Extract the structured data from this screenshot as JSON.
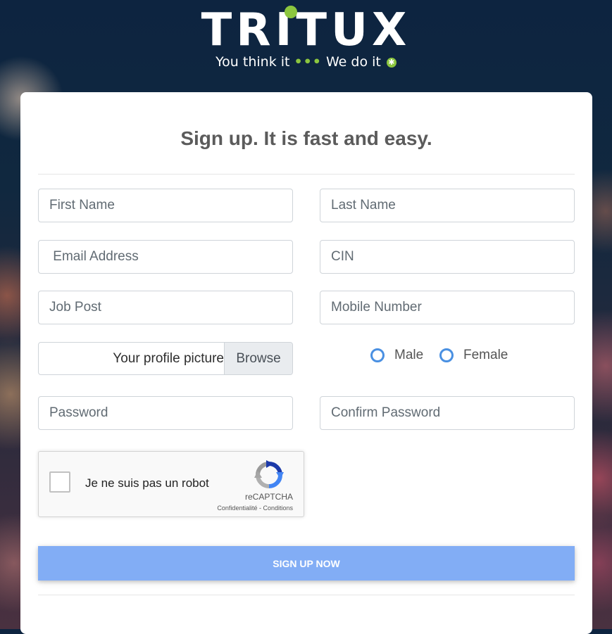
{
  "logo": {
    "name": "TRITUX",
    "tagline_part1": "You think it",
    "tagline_dots": "•••",
    "tagline_part2": "We do it",
    "tagline_symbol": "✱"
  },
  "form": {
    "title": "Sign up. It is fast and easy.",
    "fields": {
      "first_name": {
        "placeholder": "First Name",
        "value": ""
      },
      "last_name": {
        "placeholder": "Last Name",
        "value": ""
      },
      "email": {
        "placeholder": " Email Address",
        "value": ""
      },
      "cin": {
        "placeholder": "CIN",
        "value": ""
      },
      "job_post": {
        "placeholder": "Job Post",
        "value": ""
      },
      "mobile": {
        "placeholder": "Mobile Number",
        "value": ""
      },
      "password": {
        "placeholder": "Password",
        "value": ""
      },
      "confirm_password": {
        "placeholder": "Confirm Password",
        "value": ""
      }
    },
    "profile_picture": {
      "label": "Your profile picture",
      "button": "Browse"
    },
    "gender": {
      "options": [
        "Male",
        "Female"
      ],
      "selected": null
    },
    "captcha": {
      "label": "Je ne suis pas un robot",
      "brand": "reCAPTCHA",
      "privacy": "Confidentialité",
      "separator": " - ",
      "terms": "Conditions",
      "checked": false
    },
    "submit_label": "Sign up now"
  },
  "colors": {
    "accent": "#82adf5",
    "radio": "#4a90e2",
    "logo_green": "#8cc63f"
  },
  "icons": [
    "recaptcha-icon",
    "radio-icon",
    "checkbox-icon"
  ]
}
